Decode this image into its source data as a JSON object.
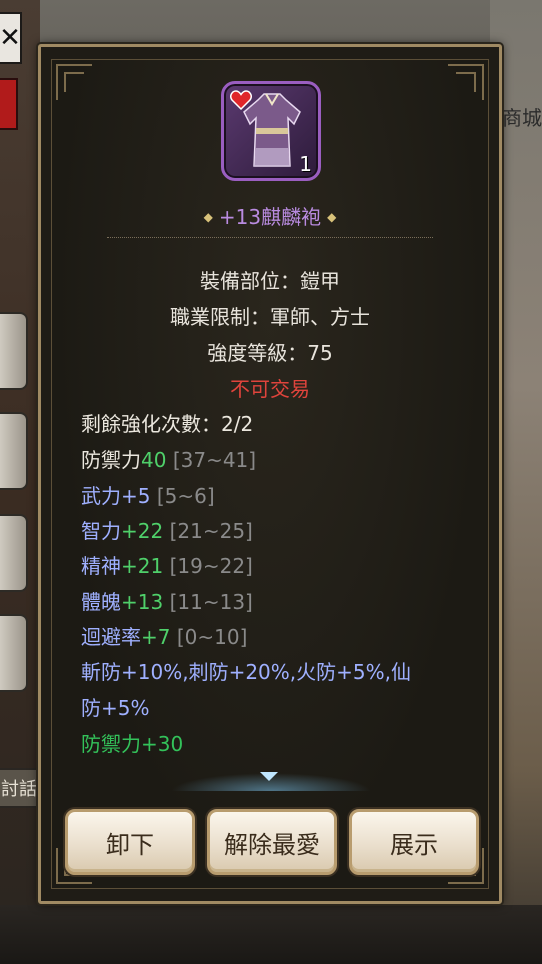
{
  "background": {
    "shop_label": "商城",
    "chat_tab": "討話"
  },
  "item": {
    "name": "+13麒麟袍",
    "count": "1",
    "rarity_color": "#9a5ec0",
    "icon": "robe-icon"
  },
  "info": {
    "slot": "裝備部位：鎧甲",
    "class_limit": "職業限制：軍師、方士",
    "strength_level": "強度等級：75",
    "untradeable": "不可交易"
  },
  "stats": {
    "remaining_enhance": "剩餘強化次數：2/2",
    "defense": {
      "label": "防禦力",
      "value": "40",
      "range": "[37~41]"
    },
    "force": {
      "label": "武力",
      "value": "+5",
      "range": "[5~6]"
    },
    "intellect": {
      "label": "智力",
      "value": "+22",
      "range": "[21~25]"
    },
    "spirit": {
      "label": "精神",
      "value": "+21",
      "range": "[19~22]"
    },
    "physique": {
      "label": "體魄",
      "value": "+13",
      "range": "[11~13]"
    },
    "evasion": {
      "label": "迴避率",
      "value": "+7",
      "range": "[0~10]"
    },
    "resist_line1": "斬防+10%,刺防+20%,火防+5%,仙",
    "resist_line2": "防+5%",
    "bonus_defense": "防禦力+30"
  },
  "buttons": {
    "unequip": "卸下",
    "unfavorite": "解除最愛",
    "show": "展示"
  },
  "colors": {
    "attr_blue": "#9fb0ff",
    "value_green": "#4fd06a",
    "untradeable_red": "#e0443c",
    "name_purple": "#b98be0"
  }
}
